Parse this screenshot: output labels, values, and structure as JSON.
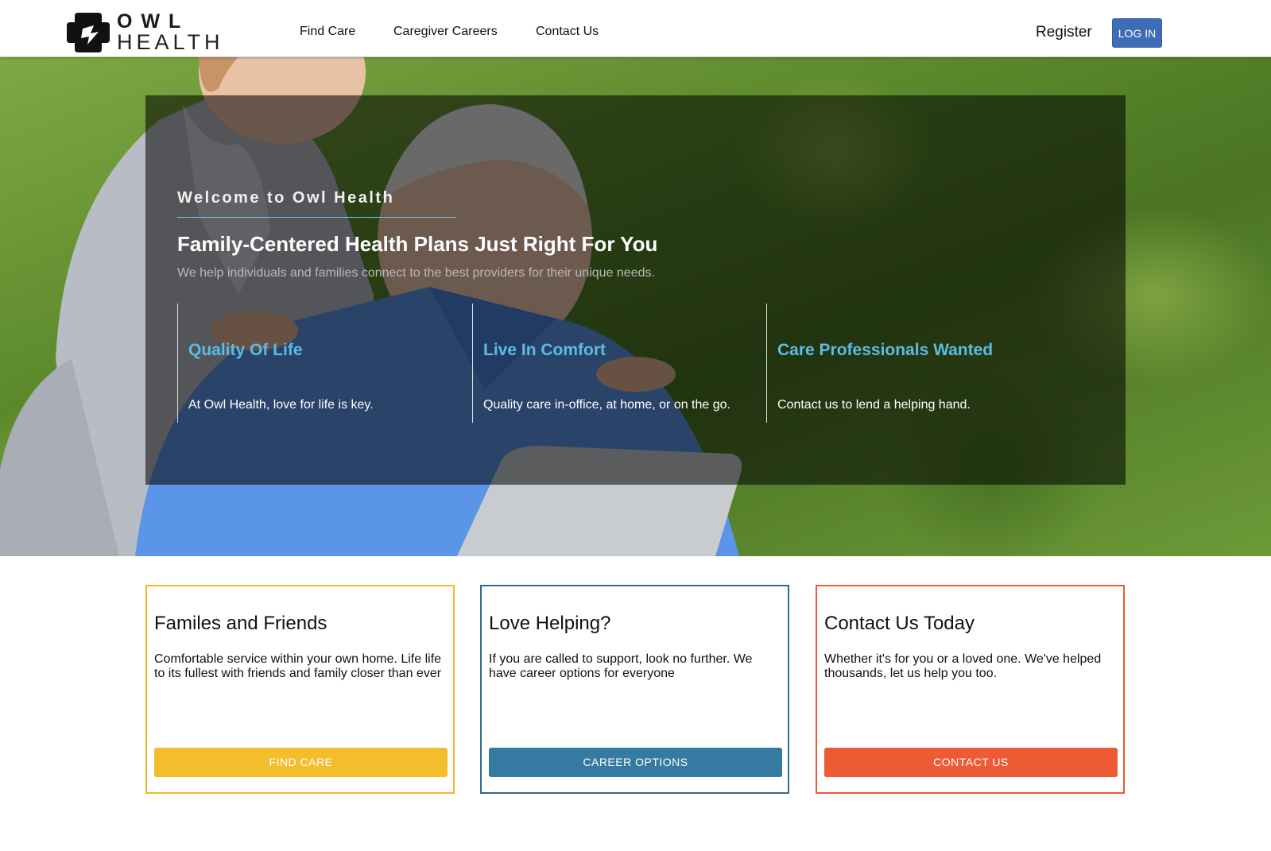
{
  "brand": {
    "line1": "OWL",
    "line2": "HEALTH"
  },
  "nav": {
    "find_care": "Find Care",
    "caregiver_careers": "Caregiver Careers",
    "contact_us": "Contact Us",
    "register": "Register",
    "login": "LOG IN"
  },
  "hero": {
    "welcome": "Welcome to Owl Health",
    "headline": "Family-Centered Health Plans Just Right For You",
    "subline": "We help individuals and families connect to the best providers for their unique needs.",
    "features": [
      {
        "title": "Quality Of Life",
        "text": "At Owl Health, love for life is key."
      },
      {
        "title": "Live In Comfort",
        "text": "Quality care in-office, at home, or on the go."
      },
      {
        "title": "Care Professionals Wanted",
        "text": "Contact us to lend a helping hand."
      }
    ]
  },
  "cards": [
    {
      "title": "Familes and Friends",
      "text": "Comfortable service within your own home. Life life to its fullest with friends and family closer than ever",
      "button": "FIND CARE",
      "color": "#f4bd2c"
    },
    {
      "title": "Love Helping?",
      "text": "If you are called to support, look no further. We have career options for everyone",
      "button": "CAREER OPTIONS",
      "color": "#357ba1"
    },
    {
      "title": "Contact Us Today",
      "text": "Whether it's for you or a loved one. We've helped thousands, let us help you too.",
      "button": "CONTACT US",
      "color": "#ec5b34"
    }
  ],
  "colors": {
    "accent_blue": "#3d6db6",
    "feature_title": "#5bbce4"
  },
  "icons": {
    "logo": "owl-health-logo-icon"
  }
}
